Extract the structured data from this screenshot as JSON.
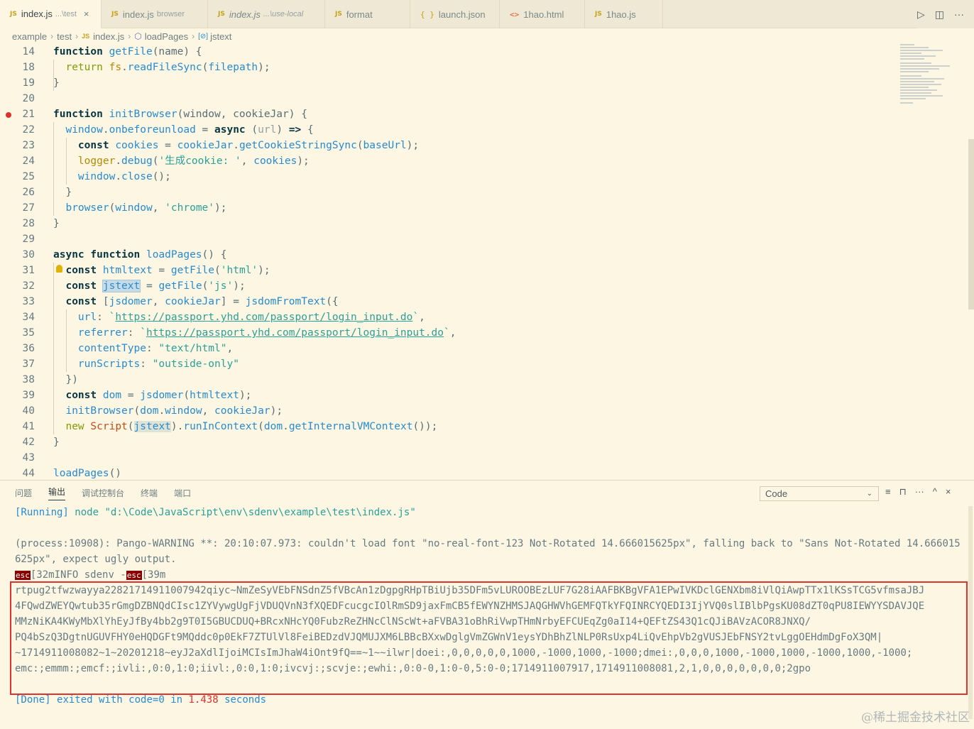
{
  "tabs": [
    {
      "badge": "JS",
      "name": "index.js",
      "desc": "...\\test",
      "active": true,
      "close": "×"
    },
    {
      "badge": "JS",
      "name": "index.js",
      "desc": "browser"
    },
    {
      "badge": "JS",
      "name": "index.js",
      "desc": "...\\use-local",
      "italic": true
    },
    {
      "badge": "JS",
      "name": "format",
      "desc": ""
    },
    {
      "badge": "{ }",
      "name": "launch.json",
      "desc": ""
    },
    {
      "badge": "<>",
      "name": "1hao.html",
      "desc": ""
    },
    {
      "badge": "JS",
      "name": "1hao.js",
      "desc": ""
    }
  ],
  "tab_actions": {
    "run": "▷",
    "split": "◫",
    "more": "···"
  },
  "breadcrumb": {
    "items": [
      "example",
      "test",
      "index.js",
      "loadPages",
      "jstext"
    ],
    "js_badge": "JS",
    "sep": "›"
  },
  "editor": {
    "line_numbers": [
      "14",
      "18",
      "19",
      "20",
      "21",
      "22",
      "23",
      "24",
      "25",
      "26",
      "27",
      "28",
      "29",
      "30",
      "31",
      "32",
      "33",
      "34",
      "35",
      "36",
      "37",
      "38",
      "39",
      "40",
      "41",
      "42",
      "43",
      "44"
    ]
  },
  "panel": {
    "tabs": [
      "问题",
      "输出",
      "调试控制台",
      "终端",
      "端口"
    ],
    "active_tab": "输出",
    "select_value": "Code",
    "actions": [
      "≡",
      "🔒",
      "···",
      "^",
      "×"
    ]
  },
  "output": {
    "running_prefix": "[Running]",
    "running_cmd": "node",
    "running_path": "\"d:\\Code\\JavaScript\\env\\sdenv\\example\\test\\index.js\"",
    "warning": "(process:10908): Pango-WARNING **: 20:10:07.973: couldn't load font \"no-real-font-123 Not-Rotated 14.666015625px\", falling back to \"Sans Not-Rotated 14.666015625px\", expect ugly output.",
    "info_esc1": "esc",
    "info_mid": "[32mINFO sdenv -",
    "info_esc2": "esc",
    "info_end": "[39m",
    "result": [
      "rtpug2tfwzwayya22821714911007942qiyc~NmZeSyVEbFNSdnZ5fVBcAn1zDgpgRHpTBiUjb35DFm5vLUROOBEzLUF7G28iAAFBKBgVFA1EPwIVKDclGENXbm8iVlQiAwpTTx1lKSsTCG5vfmsaJBJ",
      "4FQwdZWEYQwtub35rGmgDZBNQdCIsc1ZYVywgUgFjVDUQVnN3fXQEDFcucgcIOlRmSD9jaxFmCB5fEWYNZHMSJAQGHWVhGEMFQTkYFQINRCYQEDI3IjYVQ0slIBlbPgsKU08dZT0qPU8IEWYYSDAVJQE",
      "MMzNiKA4KWyMbXlYhEyJfBy4bb2g9T0I5GBUCDUQ+BRcxNHcYQ0FubzReZHNcClNScWt+aFVBA31oBhRiVwpTHmNrbyEFCUEqZg0aI14+QEFtZS43Q1cQJiBAVzACOR8JNXQ/",
      "PQ4bSzQ3DgtnUGUVFHY0eHQDGFt9MQddc0p0EkF7ZTUlVl8FeiBEDzdVJQMUJXM6LBBcBXxwDglgVmZGWnV1eysYDhBhZlNLP0RsUxp4LiQvEhpVb2gVUSJEbFNSY2tvLggOEHdmDgFoX3QM|",
      "~1714911008082~1~20201218~eyJ2aXdlIjoiMCIsImJhaW4iOnt9fQ==~1~~ilwr|doei:,0,0,0,0,0,1000,-1000,1000,-1000;dmei:,0,0,0,1000,-1000,1000,-1000,1000,-1000;",
      "emc:;emmm:;emcf:;ivli:,0:0,1:0;iivl:,0:0,1:0;ivcvj:;scvje:;ewhi:,0:0-0,1:0-0,5:0-0;1714911007917,1714911008081,2,1,0,0,0,0,0,0,0;2gpo"
    ],
    "done_prefix": "[Done]",
    "done_text": "exited with",
    "done_code": "code=0",
    "done_in": "in",
    "done_time": "1.438",
    "done_seconds": "seconds"
  },
  "watermark": "@稀土掘金技术社区",
  "colors": {
    "background": "#fdf6e3",
    "keyword": "#073642",
    "function": "#268bd2",
    "string": "#2aa198",
    "highlight_box": "#e0332f"
  }
}
